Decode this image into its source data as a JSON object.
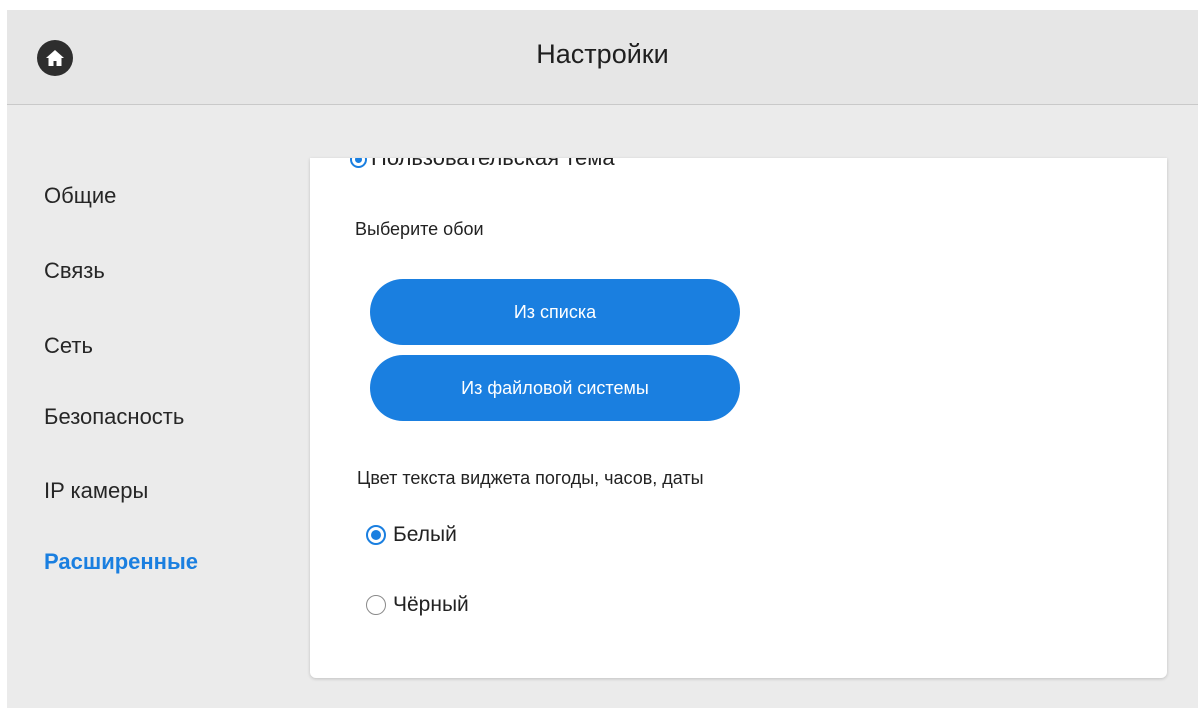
{
  "header": {
    "title": "Настройки",
    "home_icon": "home-icon"
  },
  "sidebar": {
    "items": [
      {
        "label": "Общие"
      },
      {
        "label": "Связь"
      },
      {
        "label": "Сеть"
      },
      {
        "label": "Безопасность"
      },
      {
        "label": "IP камеры"
      },
      {
        "label": "Расширенные",
        "active": true
      }
    ]
  },
  "content": {
    "theme_option_label": "Пользовательская тема",
    "wallpaper_label": "Выберите обои",
    "from_list_button": "Из списка",
    "from_filesystem_button": "Из файловой системы",
    "widget_color_label": "Цвет текста виджета погоды, часов, даты",
    "color_options": [
      {
        "label": "Белый",
        "checked": true
      },
      {
        "label": "Чёрный",
        "checked": false
      }
    ]
  },
  "colors": {
    "accent": "#1a7fe0",
    "background": "#ebebeb",
    "panel": "#ffffff"
  }
}
